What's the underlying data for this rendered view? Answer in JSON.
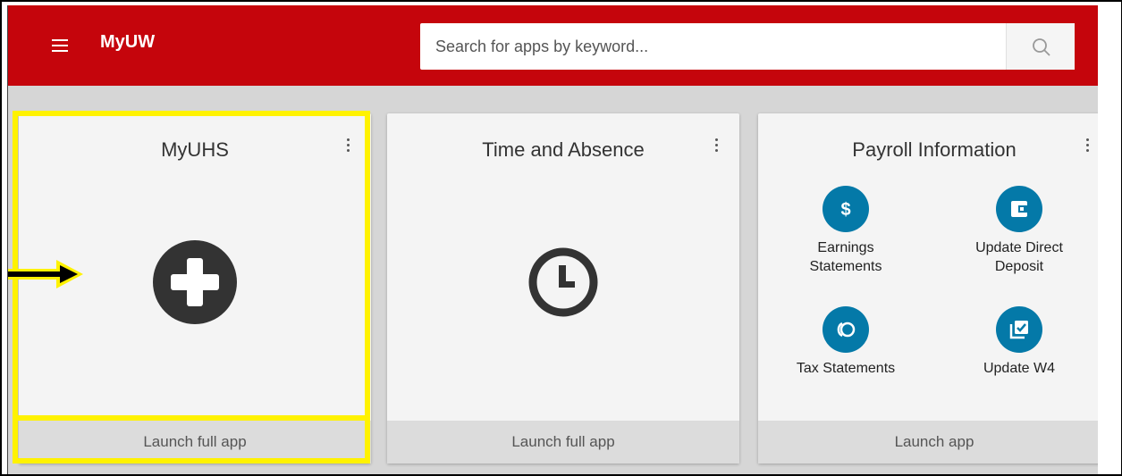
{
  "header": {
    "app_title": "MyUW",
    "search_placeholder": "Search for apps by keyword..."
  },
  "cards": [
    {
      "title": "MyUHS",
      "icon": "medical-plus-icon",
      "footer": "Launch full app"
    },
    {
      "title": "Time and Absence",
      "icon": "clock-icon",
      "footer": "Launch full app"
    },
    {
      "title": "Payroll Information",
      "footer": "Launch app",
      "links": [
        {
          "label_line1": "Earnings",
          "label_line2": "Statements",
          "icon": "dollar-icon"
        },
        {
          "label_line1": "Update Direct",
          "label_line2": "Deposit",
          "icon": "wallet-icon"
        },
        {
          "label_line1": "Tax Statements",
          "label_line2": "",
          "icon": "tax-icon"
        },
        {
          "label_line1": "Update W4",
          "label_line2": "",
          "icon": "check-doc-icon"
        }
      ]
    }
  ],
  "colors": {
    "brand": "#c5050c",
    "highlight": "#fff200",
    "link_circle": "#0479a8"
  }
}
